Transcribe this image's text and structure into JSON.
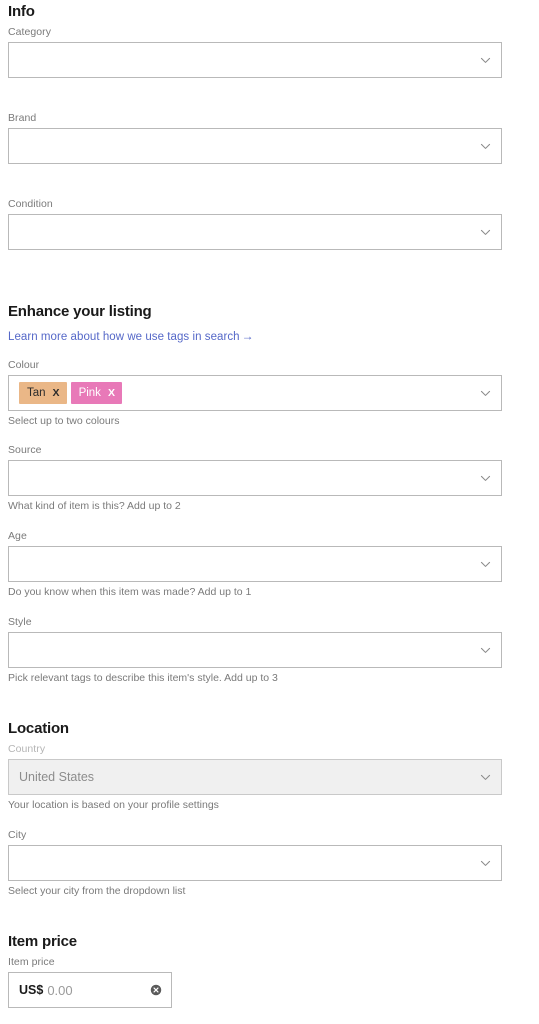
{
  "sections": {
    "info": {
      "title": "Info",
      "fields": [
        {
          "label": "Category",
          "value": "",
          "helper": ""
        },
        {
          "label": "Brand",
          "value": "",
          "helper": ""
        },
        {
          "label": "Condition",
          "value": "",
          "helper": ""
        }
      ]
    },
    "enhance": {
      "title": "Enhance your listing",
      "link": {
        "text": "Learn more about how we use tags in search",
        "arrow": "→"
      },
      "colour": {
        "label": "Colour",
        "helper": "Select up to two colours",
        "chips": [
          {
            "label": "Tan",
            "remove": "X",
            "bg": "#eab787",
            "fg": "#2b2b2b"
          },
          {
            "label": "Pink",
            "remove": "X",
            "bg": "#e879b8",
            "fg": "#ffffff"
          }
        ]
      },
      "source": {
        "label": "Source",
        "value": "",
        "helper": "What kind of item is this? Add up to 2"
      },
      "age": {
        "label": "Age",
        "value": "",
        "helper": "Do you know when this item was made? Add up to 1"
      },
      "style": {
        "label": "Style",
        "value": "",
        "helper": "Pick relevant tags to describe this item's style. Add up to 3"
      }
    },
    "location": {
      "title": "Location",
      "country": {
        "label": "Country",
        "value": "United States",
        "helper": "Your location is based on your profile settings",
        "disabled": true
      },
      "city": {
        "label": "City",
        "value": "",
        "helper": "Select your city from the dropdown list"
      }
    },
    "price": {
      "title": "Item price",
      "label": "Item price",
      "currency": "US$",
      "amount": "0.00"
    }
  },
  "icons": {
    "chevron": "chevron-down-icon",
    "clear": "clear-circle-icon"
  },
  "colors": {
    "link": "#5568c8",
    "border": "#b9b9b9",
    "label": "#7a7a7a",
    "disabled_bg": "#f0f0f0"
  }
}
